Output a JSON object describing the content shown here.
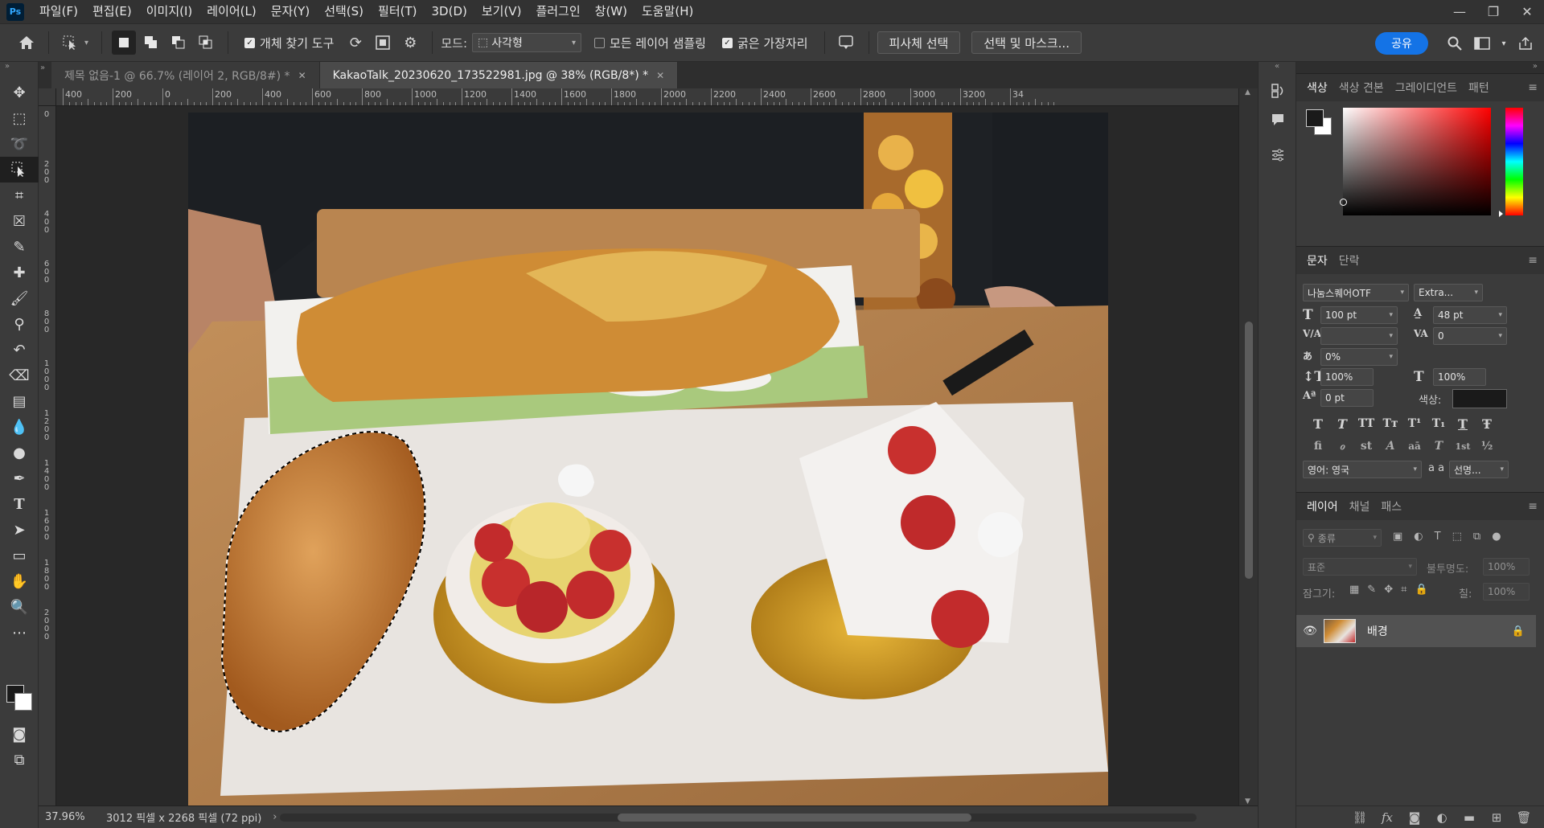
{
  "app": {
    "logo": "Ps"
  },
  "menu": [
    "파일(F)",
    "편집(E)",
    "이미지(I)",
    "레이어(L)",
    "문자(Y)",
    "선택(S)",
    "필터(T)",
    "3D(D)",
    "보기(V)",
    "플러그인",
    "창(W)",
    "도움말(H)"
  ],
  "options": {
    "object_finder_label": "개체 찾기 도구",
    "mode_label": "모드:",
    "mode_value": "사각형",
    "sample_all_layers_label": "모든 레이어 샘플링",
    "hard_edge_label": "굵은 가장자리",
    "select_subject_label": "피사체 선택",
    "select_and_mask_label": "선택 및 마스크...",
    "share_label": "공유"
  },
  "tabs": [
    {
      "label": "제목 없음-1 @ 66.7% (레이어 2, RGB/8#) *",
      "active": false
    },
    {
      "label": "KakaoTalk_20230620_173522981.jpg @ 38% (RGB/8*) *",
      "active": true
    }
  ],
  "ruler": {
    "top_labels": [
      "400",
      "200",
      "0",
      "200",
      "400",
      "600",
      "800",
      "1000",
      "1200",
      "1400",
      "1600",
      "1800",
      "2000",
      "2200",
      "2400",
      "2600",
      "2800",
      "3000",
      "3200",
      "34"
    ],
    "left_labels": [
      "0",
      "200",
      "400",
      "600",
      "800",
      "1000",
      "1200",
      "1400",
      "1600",
      "1800",
      "2000"
    ]
  },
  "status": {
    "zoom": "37.96%",
    "doc_info": "3012 픽셀 x 2268 픽셀 (72 ppi)"
  },
  "color_panel": {
    "tabs": [
      "색상",
      "색상 견본",
      "그레이디언트",
      "패턴"
    ],
    "foreground": "#1a1a1a",
    "background": "#ffffff",
    "field_hue": "#ff0000"
  },
  "character_panel": {
    "tabs": [
      "문자",
      "단락"
    ],
    "font_family": "나눔스퀘어OTF",
    "font_style": "Extra...",
    "font_size": "100 pt",
    "leading": "48 pt",
    "kerning": "",
    "tracking": "0",
    "tsume": "0%",
    "vertical_scale": "100%",
    "horizontal_scale": "100%",
    "baseline_shift": "0 pt",
    "color_label": "색상:",
    "language": "영어: 영국",
    "antialias": "선명...",
    "antialias_icon_label": "a a",
    "style_buttons": [
      "T",
      "T",
      "TT",
      "Tт",
      "T¹",
      "T₁",
      "T",
      "Ŧ"
    ],
    "opentype_buttons": [
      "fi",
      "ℴ",
      "st",
      "A",
      "aā",
      "T",
      "1st",
      "½"
    ]
  },
  "layers_panel": {
    "tabs": [
      "레이어",
      "채널",
      "패스"
    ],
    "filter_placeholder": "종류",
    "blend_mode": "표준",
    "opacity_label": "불투명도:",
    "opacity_value": "100%",
    "lock_label": "잠그기:",
    "fill_label": "칠:",
    "fill_value": "100%",
    "layers": [
      {
        "name": "배경",
        "visible": true,
        "locked": true
      }
    ]
  }
}
